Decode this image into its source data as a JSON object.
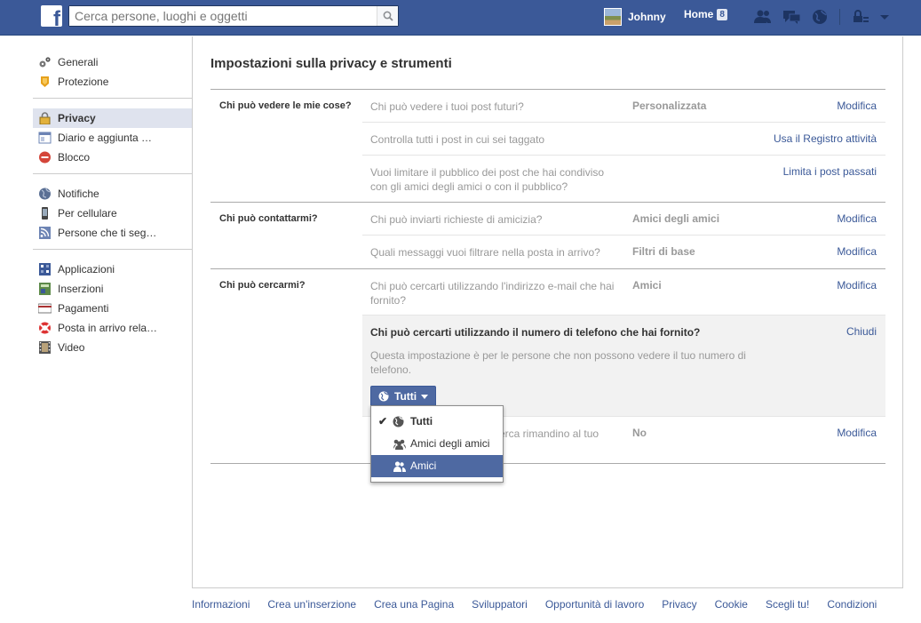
{
  "topbar": {
    "search_placeholder": "Cerca persone, luoghi e oggetti",
    "user_name": "Johnny",
    "home_label": "Home",
    "home_count": "8"
  },
  "sidebar": {
    "groups": [
      [
        {
          "label": "Generali",
          "icon": "gears-icon"
        },
        {
          "label": "Protezione",
          "icon": "badge-icon"
        }
      ],
      [
        {
          "label": "Privacy",
          "icon": "lock-icon",
          "active": true
        },
        {
          "label": "Diario e aggiunta …",
          "icon": "timeline-icon"
        },
        {
          "label": "Blocco",
          "icon": "block-icon"
        }
      ],
      [
        {
          "label": "Notifiche",
          "icon": "globe-icon"
        },
        {
          "label": "Per cellulare",
          "icon": "phone-icon"
        },
        {
          "label": "Persone che ti seg…",
          "icon": "rss-icon"
        }
      ],
      [
        {
          "label": "Applicazioni",
          "icon": "apps-icon"
        },
        {
          "label": "Inserzioni",
          "icon": "ads-icon"
        },
        {
          "label": "Pagamenti",
          "icon": "card-icon"
        },
        {
          "label": "Posta in arrivo rela…",
          "icon": "lifebuoy-icon"
        },
        {
          "label": "Video",
          "icon": "film-icon"
        }
      ]
    ]
  },
  "page_title": "Impostazioni sulla privacy e strumenti",
  "sections": [
    {
      "label": "Chi può vedere le mie cose?",
      "rows": [
        {
          "q": "Chi può vedere i tuoi post futuri?",
          "val": "Personalizzata",
          "act": "Modifica"
        },
        {
          "q": "Controlla tutti i post in cui sei taggato",
          "val": "",
          "act": "Usa il Registro attività"
        },
        {
          "q": "Vuoi limitare il pubblico dei post che hai condiviso con gli amici degli amici o con il pubblico?",
          "val": "",
          "act": "Limita i post passati"
        }
      ]
    },
    {
      "label": "Chi può contattarmi?",
      "rows": [
        {
          "q": "Chi può inviarti richieste di amicizia?",
          "val": "Amici degli amici",
          "act": "Modifica"
        },
        {
          "q": "Quali messaggi vuoi filtrare nella posta in arrivo?",
          "val": "Filtri di base",
          "act": "Modifica"
        }
      ]
    },
    {
      "label": "Chi può cercarmi?",
      "rows": [
        {
          "q": "Chi può cercarti utilizzando l'indirizzo e-mail che hai fornito?",
          "val": "Amici",
          "act": "Modifica"
        }
      ],
      "expanded": {
        "q": "Chi può cercarti utilizzando il numero di telefono che hai fornito?",
        "act": "Chiudi",
        "desc": "Questa impostazione è per le persone che non possono vedere il tuo numero di telefono.",
        "button_label": "Tutti"
      },
      "last_row": {
        "q": "Vuoi che i motori di ricerca rimandino al tuo diario?",
        "q_visible": "cerca rimandino al tuo",
        "val": "No",
        "act": "Modifica"
      }
    }
  ],
  "dropdown": {
    "items": [
      {
        "label": "Tutti",
        "checked": true,
        "icon": "globe-icon"
      },
      {
        "label": "Amici degli amici",
        "checked": false,
        "icon": "friends-of-friends-icon"
      },
      {
        "label": "Amici",
        "checked": false,
        "icon": "friends-icon",
        "highlighted": true
      }
    ]
  },
  "footer": {
    "links": [
      "Informazioni",
      "Crea un'inserzione",
      "Crea una Pagina",
      "Sviluppatori",
      "Opportunità di lavoro",
      "Privacy",
      "Cookie",
      "Scegli tu!",
      "Condizioni"
    ]
  },
  "colors": {
    "brand": "#3b5998",
    "button": "#4e69a2",
    "link": "#3b5998"
  }
}
